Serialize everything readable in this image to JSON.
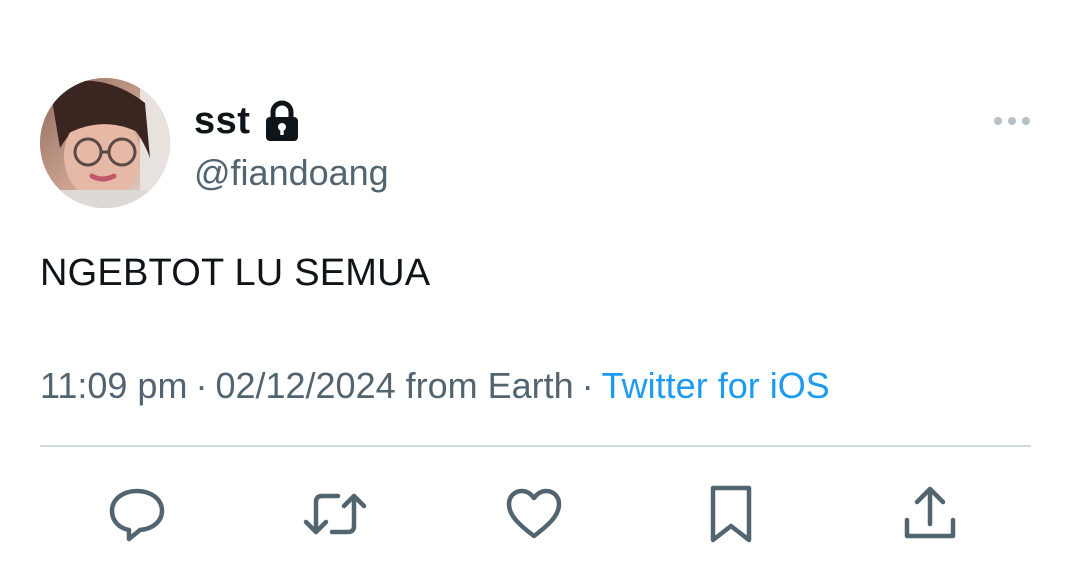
{
  "user": {
    "display_name": "sst",
    "handle": "@fiandoang",
    "protected_icon": "lock-icon",
    "avatar": "avatar"
  },
  "tweet": {
    "text": "NGEBTOT LU SEMUA",
    "time": "11:09 pm",
    "separator": "·",
    "date_location": "02/12/2024 from Earth",
    "source": "Twitter for iOS"
  },
  "actions": {
    "more": "more-icon",
    "reply": "reply-icon",
    "retweet": "retweet-icon",
    "like": "like-icon",
    "bookmark": "bookmark-icon",
    "share": "share-icon"
  },
  "colors": {
    "text_primary": "#0f1419",
    "text_secondary": "#536471",
    "link": "#1d9bf0",
    "divider": "#cfd9de"
  }
}
